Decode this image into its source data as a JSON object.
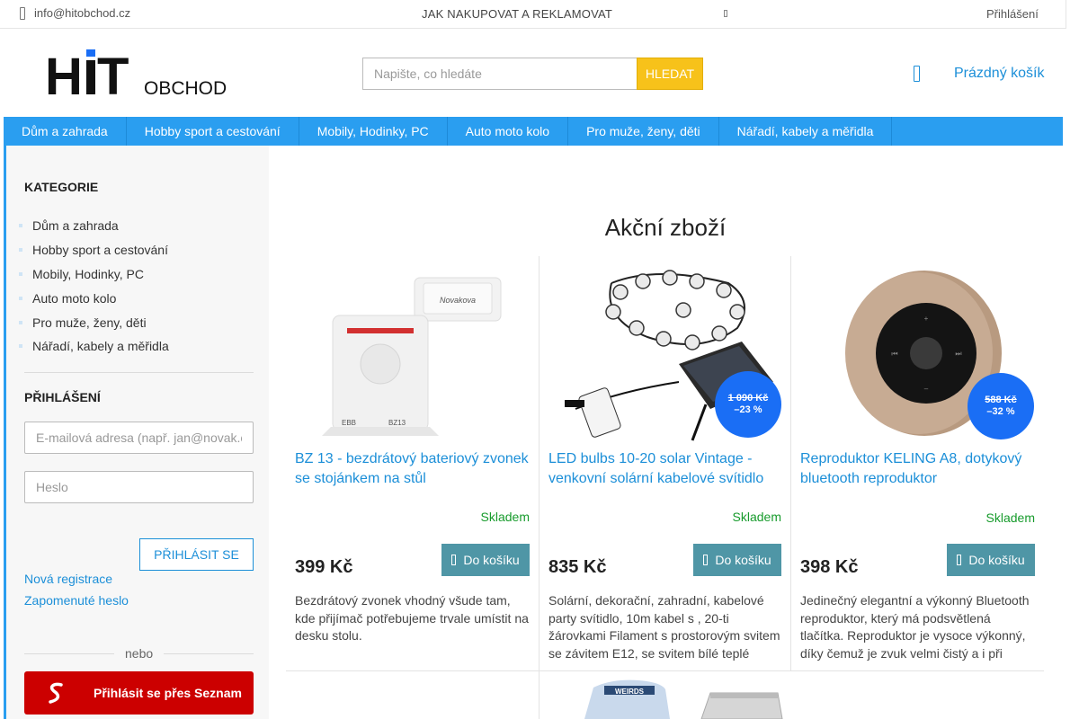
{
  "topbar": {
    "email": "info@hitobchod.cz",
    "howto": "JAK NAKUPOVAT A REKLAMOVAT",
    "login": "Přihlášení"
  },
  "header": {
    "logo_text": "HiT",
    "logo_sub": "OBCHOD",
    "search_placeholder": "Napište, co hledáte",
    "search_button": "HLEDAT",
    "cart_label": "Prázdný košík"
  },
  "nav": [
    "Dům a zahrada",
    "Hobby sport a cestování",
    "Mobily, Hodinky, PC",
    "Auto moto kolo",
    "Pro muže, ženy, děti",
    "Nářadí, kabely a měřidla"
  ],
  "sidebar": {
    "categories_title": "KATEGORIE",
    "categories": [
      "Dům a zahrada",
      "Hobby sport a cestování",
      "Mobily, Hodinky, PC",
      "Auto moto kolo",
      "Pro muže, ženy, děti",
      "Nářadí, kabely a měřidla"
    ],
    "login_title": "PŘIHLÁŠENÍ",
    "email_placeholder": "E-mailová adresa (např. jan@novak.cz)",
    "password_placeholder": "Heslo",
    "login_button": "PŘIHLÁSIT SE",
    "register_link": "Nová registrace",
    "forgot_link": "Zapomenuté heslo",
    "or_text": "nebo",
    "seznam_button": "Přihlásit se přes Seznam"
  },
  "main": {
    "title": "Akční zboží",
    "products": [
      {
        "name": "BZ 13 - bezdrátový bateriový zvonek se stojánkem na stůl",
        "stock": "Skladem",
        "price": "399 Kč",
        "add_button": "Do košíku",
        "description": "Bezdrátový zvonek vhodný všude tam, kde přijímač potřebujeme trvale umístit na desku stolu."
      },
      {
        "name": "LED bulbs 10-20 solar Vintage - venkovní solární kabelové svítidlo",
        "stock": "Skladem",
        "price": "835 Kč",
        "add_button": "Do košíku",
        "old_price": "1 090 Kč",
        "discount": "–23 %",
        "description": "Solární, dekorační, zahradní, kabelové party svítidlo, 10m kabel s , 20-ti žárovkami Filament s prostorovým svitem se závitem E12, se svitem bílé teplé"
      },
      {
        "name": "Reproduktor KELING A8, dotykový bluetooth reproduktor",
        "stock": "Skladem",
        "price": "398 Kč",
        "add_button": "Do košíku",
        "old_price": "588 Kč",
        "discount": "–32 %",
        "description": "Jedinečný elegantní a výkonný Bluetooth reproduktor, který má podsvětlená tlačítka. Reproduktor je vysoce výkonný, díky čemuž je zvuk velmi čistý a i při"
      }
    ]
  },
  "colors": {
    "accent": "#2a9ef0",
    "link": "#1c8fd8",
    "search_button": "#f7c21a",
    "badge": "#1a6ef5",
    "cart_button": "#4f96a6",
    "stock": "#179b2c",
    "seznam": "#cc0000"
  }
}
